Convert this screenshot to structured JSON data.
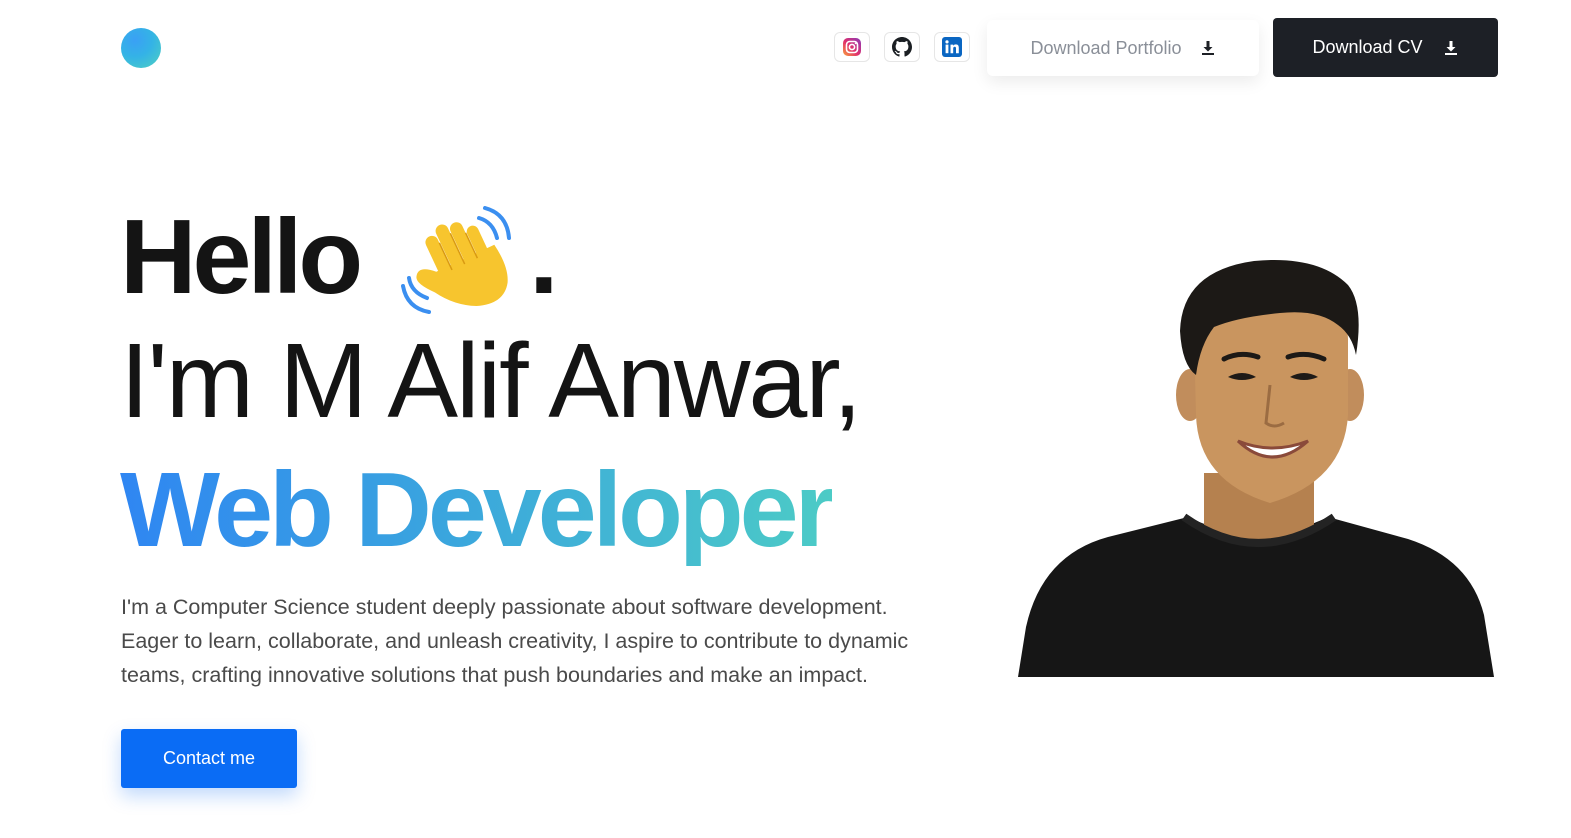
{
  "header": {
    "logo": {
      "icon": "gradient-circle-logo",
      "colors": [
        "#3aa0f5",
        "#4fd1c0"
      ]
    },
    "social": [
      {
        "name": "instagram",
        "icon": "instagram-icon"
      },
      {
        "name": "github",
        "icon": "github-icon"
      },
      {
        "name": "linkedin",
        "icon": "linkedin-icon"
      }
    ],
    "download_portfolio": {
      "label": "Download Portfolio",
      "icon": "download-icon"
    },
    "download_cv": {
      "label": "Download CV",
      "icon": "download-icon"
    }
  },
  "hero": {
    "greeting": "Hello",
    "greeting_emoji": "waving-hand-icon",
    "greeting_punct": ".",
    "name_line": "I'm M Alif Anwar,",
    "role": "Web Developer",
    "role_gradient": [
      "#2f86f2",
      "#4ccbc6"
    ],
    "bio": [
      "I'm a Computer Science student deeply passionate about software development.",
      "Eager to learn, collaborate, and unleash creativity, I aspire to contribute to dynamic",
      "teams, crafting innovative solutions that push boundaries and make an impact."
    ],
    "contact_button": "Contact me",
    "portrait": {
      "icon": "profile-photo"
    }
  },
  "colors": {
    "primary": "#0a6cf5",
    "dark_button": "#1d2026",
    "heading": "#141414",
    "body_text": "#4a4a4a"
  }
}
